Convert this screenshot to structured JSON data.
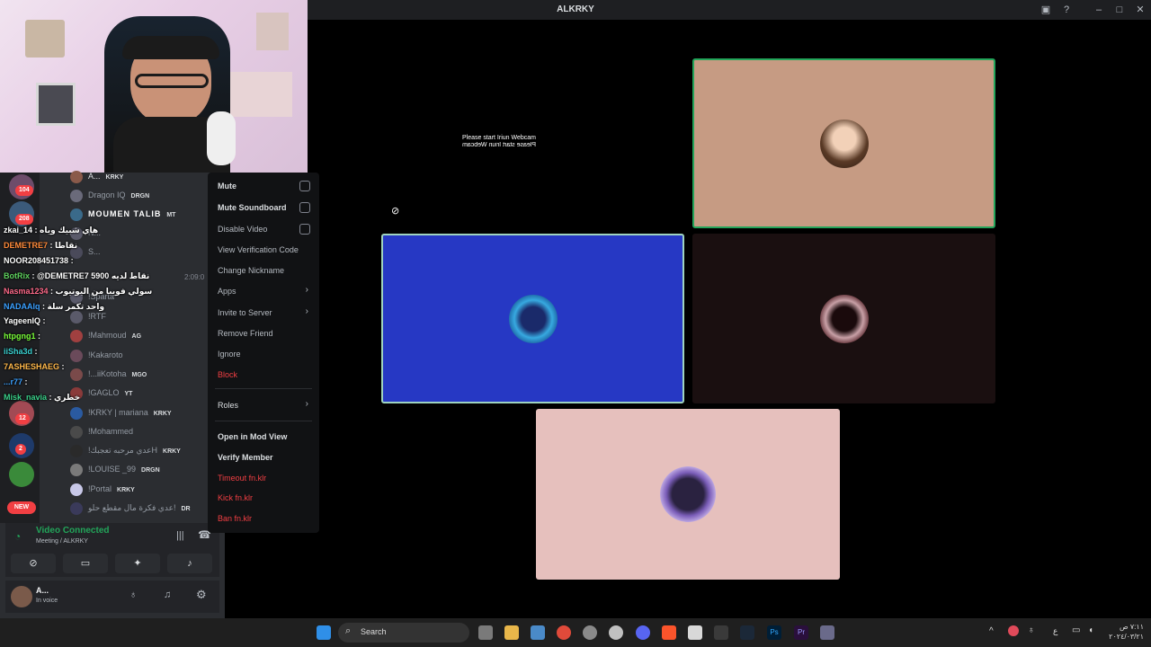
{
  "window": {
    "title": "ALKRKY"
  },
  "stage": {
    "webcam_text": "Please start Iriun Webcam",
    "webcam_text_mirror": "Please start Iriun Webcam"
  },
  "context_menu": {
    "items": [
      {
        "label": "Mute",
        "type": "check"
      },
      {
        "label": "Mute Soundboard",
        "type": "check"
      },
      {
        "label": "Disable Video",
        "type": "check"
      },
      {
        "label": "View Verification Code",
        "type": "plain"
      },
      {
        "label": "Change Nickname",
        "type": "plain"
      },
      {
        "label": "Apps",
        "type": "submenu"
      },
      {
        "label": "Invite to Server",
        "type": "submenu"
      },
      {
        "label": "Remove Friend",
        "type": "plain"
      },
      {
        "label": "Ignore",
        "type": "plain"
      },
      {
        "label": "Block",
        "type": "danger"
      },
      {
        "label": "Roles",
        "type": "submenu"
      },
      {
        "label": "Open in Mod View",
        "type": "plain"
      },
      {
        "label": "Verify Member",
        "type": "plain"
      },
      {
        "label": "Timeout fn.klr",
        "type": "danger"
      },
      {
        "label": "Kick fn.klr",
        "type": "danger"
      },
      {
        "label": "Ban fn.klr",
        "type": "danger"
      }
    ]
  },
  "members": [
    {
      "name": "A...",
      "tag": "KRKY"
    },
    {
      "name": "Dragon IQ",
      "tag": "DRGN"
    },
    {
      "name": "MOUMEN TALIB",
      "tag": "MT"
    },
    {
      "name": "N...",
      "tag": ""
    },
    {
      "name": "S...",
      "tag": ""
    },
    {
      "name": "!Sparta",
      "tag": ""
    },
    {
      "name": "!RTF",
      "tag": ""
    },
    {
      "name": "!Mahmoud",
      "tag": "AG"
    },
    {
      "name": "!Kakaroto",
      "tag": ""
    },
    {
      "name": "!...iiKotoha",
      "tag": "MGO"
    },
    {
      "name": "!GAGLO",
      "tag": "YT"
    },
    {
      "name": "!KRKY | mariana",
      "tag": "KRKY"
    },
    {
      "name": "!Mohammed",
      "tag": ""
    },
    {
      "name": "!عدي مرحبه تعجبكH",
      "tag": "KRKY"
    },
    {
      "name": "!LOUISE _99",
      "tag": "DRGN"
    },
    {
      "name": "!Portal",
      "tag": "KRKY"
    },
    {
      "name": "عدي فكرة مال مقطع حلو!",
      "tag": "DR"
    }
  ],
  "servers": {
    "badges": [
      "104",
      "208",
      "12",
      "2"
    ],
    "new_label": "NEW"
  },
  "chat": [
    {
      "user": "zkai_14",
      "text": "هاي شبيك وياه"
    },
    {
      "user": "DEMETRE7",
      "text": "نقاطا"
    },
    {
      "user": "NOOR208451738",
      "text": ""
    },
    {
      "user": "BotRix",
      "text": "@DEMETRE7 5900 نقاط لديه"
    },
    {
      "user": "Nasma1234",
      "text": "سولي فويبا من اليوتيوب"
    },
    {
      "user": "NADAAlq",
      "text": "واحد تكمر سلة"
    },
    {
      "user": "YageenIQ",
      "text": ""
    },
    {
      "user": "htpgng1",
      "text": ""
    },
    {
      "user": "iiSha3d",
      "text": ""
    },
    {
      "user": "7ASHESHAEG",
      "text": ""
    },
    {
      "user": "...r77",
      "text": ""
    },
    {
      "user": "Misk_navia",
      "text": "خطري"
    }
  ],
  "chat_time": "2:09:0",
  "voice": {
    "status": "Video Connected",
    "channel": "Meeting / ALKRKY"
  },
  "user": {
    "name": "A...",
    "status": "In voice"
  },
  "taskbar": {
    "search_placeholder": "Search",
    "clock_time": "٧:١١ ص",
    "clock_date": "٢٠٢٤/٠٣/٢١",
    "lang": "ع"
  },
  "colors": {
    "accent": "#5865f2",
    "green": "#23a55a",
    "danger": "#f23f43"
  }
}
